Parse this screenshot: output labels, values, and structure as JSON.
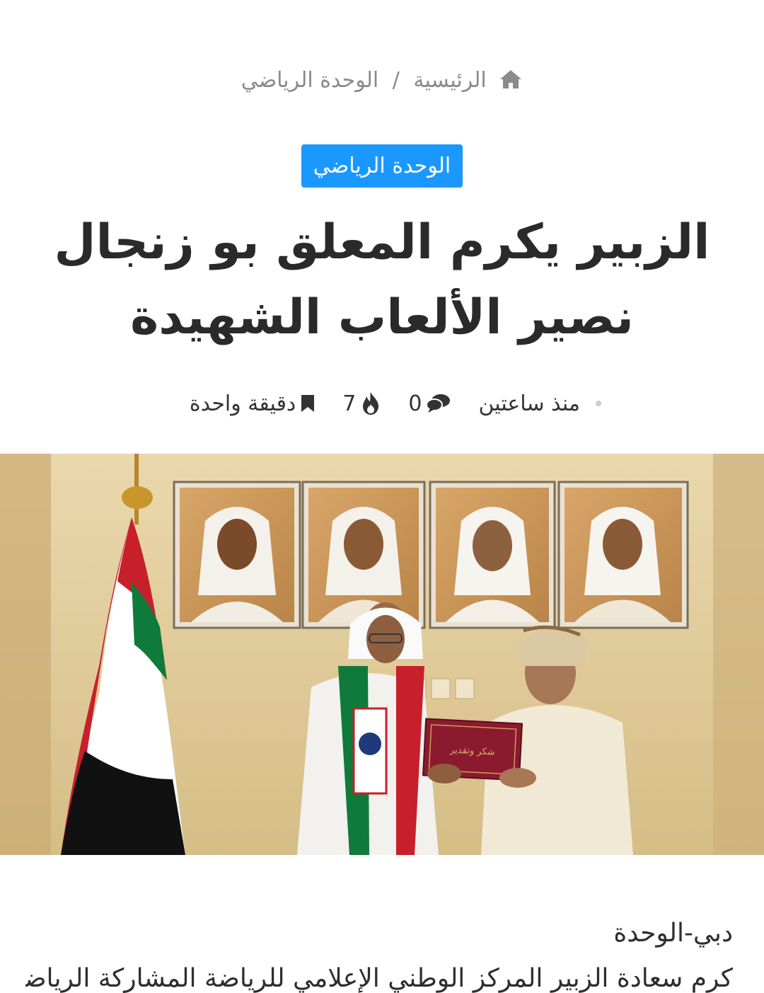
{
  "breadcrumb": {
    "home": "الرئيسية",
    "separator": "/",
    "current": "الوحدة الرياضي"
  },
  "category": {
    "label": "الوحدة الرياضي",
    "color": "#1a98ff"
  },
  "article": {
    "title_line1": "الزبير يكرم المعلق بو زنجال",
    "title_line2": "نصير الألعاب الشهيدة",
    "meta": {
      "time": "منذ ساعتين",
      "comments": "0",
      "views": "7",
      "read_time": "دقيقة واحدة"
    },
    "dateline": "دبي-الوحدة",
    "first_line": "كرم سعادة الزبير المركز الوطني الإعلامي للرياضة المشاركة الرياضية الم"
  },
  "hero": {
    "plaque_text": "شكر وتقدير"
  },
  "icons": {
    "home": "home-icon",
    "comments": "comments-icon",
    "views": "fire-icon",
    "read_time": "bookmark-icon"
  }
}
